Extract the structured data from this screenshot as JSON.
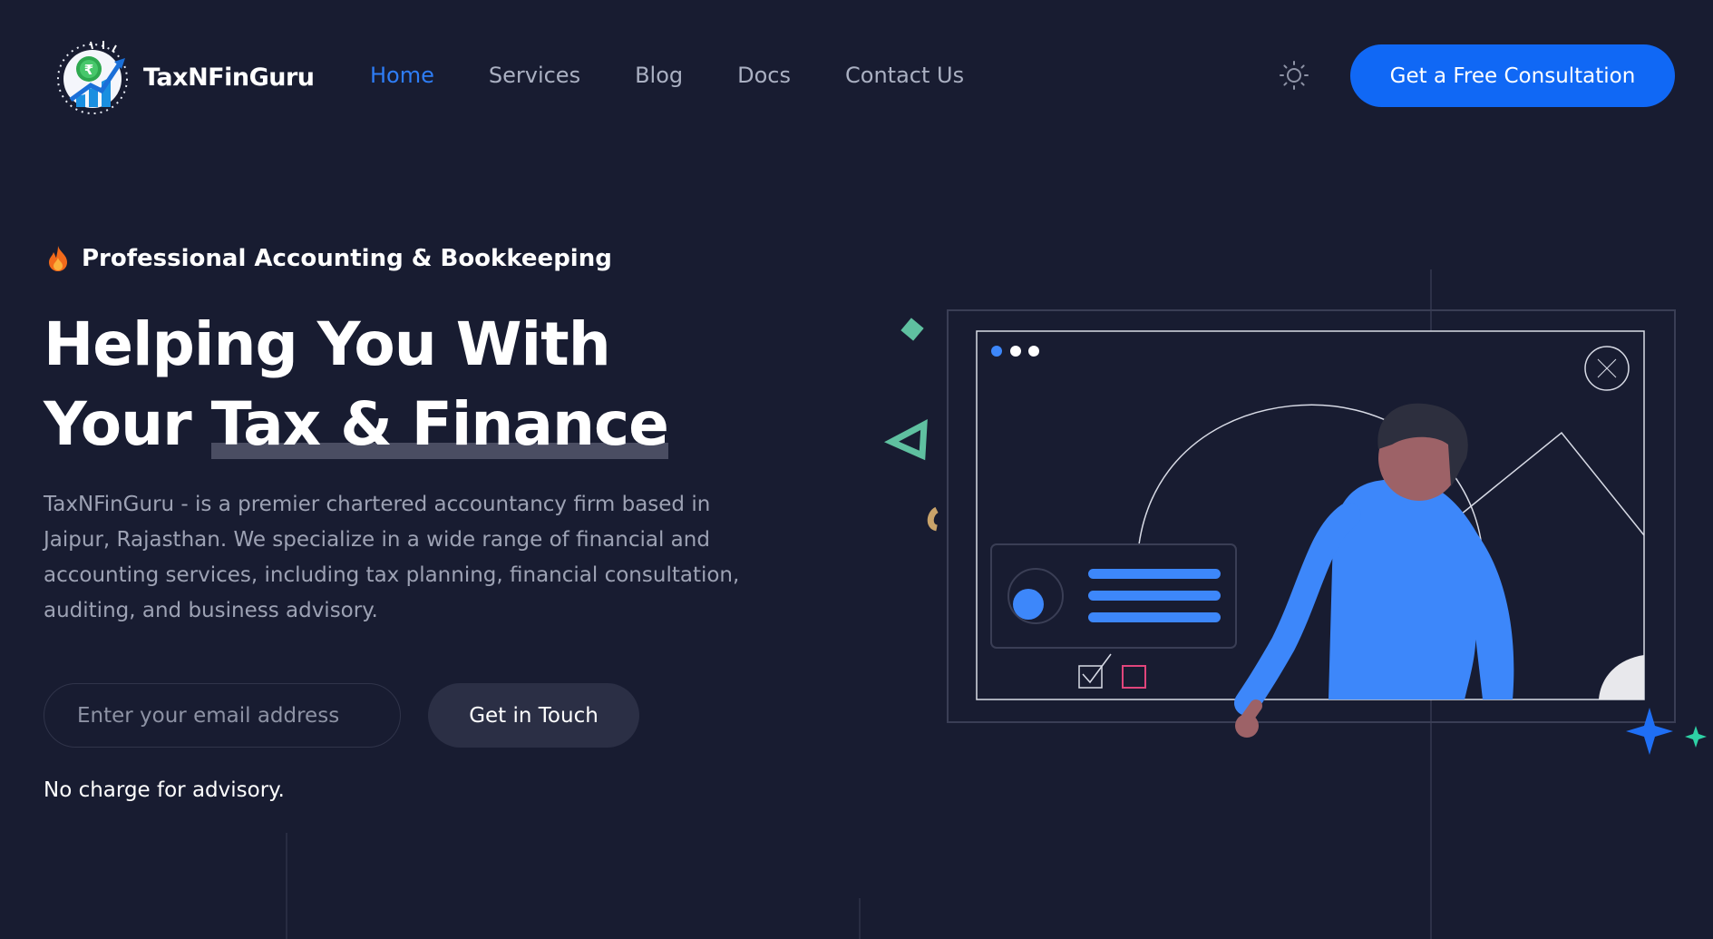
{
  "header": {
    "brand": "TaxNFinGuru",
    "nav": [
      {
        "label": "Home",
        "active": true
      },
      {
        "label": "Services",
        "active": false
      },
      {
        "label": "Blog",
        "active": false
      },
      {
        "label": "Docs",
        "active": false
      },
      {
        "label": "Contact Us",
        "active": false
      }
    ],
    "theme_icon": "sun-icon",
    "cta_label": "Get a Free Consultation"
  },
  "hero": {
    "tag_icon": "fire-icon",
    "tag_label": "Professional Accounting & Bookkeeping",
    "headline_line1": "Helping You With",
    "headline_line2_prefix": "Your ",
    "headline_highlight": "Tax & Finance",
    "description": "TaxNFinGuru - is a premier chartered accountancy firm based in Jaipur, Rajasthan. We specialize in a wide range of financial and accounting services, including tax planning, financial consultation, auditing, and business advisory.",
    "email_placeholder": "Enter your email address",
    "button_label": "Get in Touch",
    "note": "No charge for advisory."
  },
  "colors": {
    "background": "#181c31",
    "accent": "#1068f5",
    "nav_active": "#2e7df6",
    "illustration_blue": "#3d87fa",
    "skin": "#9d6267"
  }
}
